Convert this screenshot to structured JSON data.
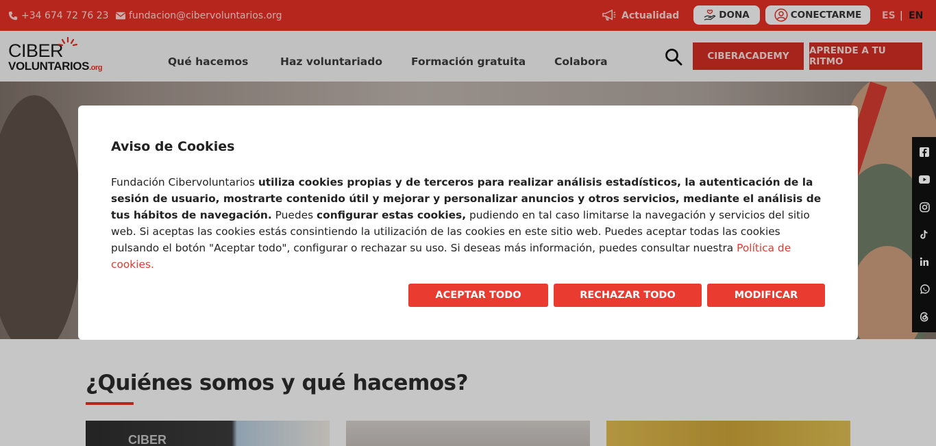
{
  "topbar": {
    "phone": "+34 674 72 76 23",
    "email": "fundacion@cibervoluntarios.org",
    "news_label": "Actualidad",
    "donate_label": "DONA",
    "connect_label": "CONECTARME",
    "lang_es": "ES",
    "lang_sep": "|",
    "lang_en": "EN"
  },
  "header": {
    "logo_line1": "CIBER",
    "logo_line2": "VOLUNTARIOS",
    "logo_suffix": ".org",
    "nav": [
      "Qué hacemos",
      "Haz voluntariado",
      "Formación gratuita",
      "Colabora"
    ],
    "btn_academy": "CIBERACADEMY",
    "btn_learn": "APRENDE A TU RITMO"
  },
  "social": [
    "facebook-icon",
    "youtube-icon",
    "instagram-icon",
    "tiktok-icon",
    "linkedin-icon",
    "whatsapp-icon",
    "threads-icon"
  ],
  "modal": {
    "title": "Aviso de Cookies",
    "t1": "Fundación Cibervoluntarios ",
    "t2": "utiliza cookies propias y de terceros para realizar análisis estadísticos, la autenticación de la sesión de usuario, mostrarte contenido útil y mejorar y personalizar anuncios y otros servicios, mediante el análisis de tus hábitos de navegación.",
    "t3": " Puedes ",
    "t4": "configurar estas cookies,",
    "t5": " pudiendo en tal caso limitarse la navegación y servicios del sitio web. Si aceptas las cookies estás consintiendo la utilización de las cookies en este sitio web. Puedes aceptar todas las cookies pulsando el botón \"Aceptar todo\", configurar o rechazar su uso. Si deseas más información, puedes consultar nuestra ",
    "link": "Política de cookies.",
    "accept": "ACEPTAR TODO",
    "reject": "RECHAZAR TODO",
    "modify": "MODIFICAR"
  },
  "main": {
    "section_title": "¿Quiénes somos y qué hacemos?",
    "card1_text": "CIBER"
  },
  "colors": {
    "brand_red": "#e02f24",
    "button_red": "#ea3b31"
  }
}
